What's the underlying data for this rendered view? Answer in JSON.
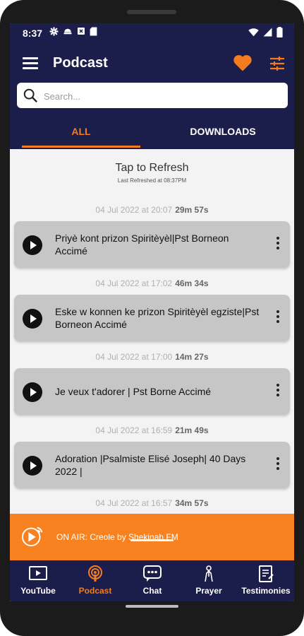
{
  "status_bar": {
    "time": "8:37"
  },
  "app_bar": {
    "title": "Podcast"
  },
  "search": {
    "placeholder": "Search..."
  },
  "tabs": [
    {
      "label": "ALL",
      "selected": true
    },
    {
      "label": "DOWNLOADS",
      "selected": false
    }
  ],
  "refresh": {
    "title": "Tap to Refresh",
    "subtitle": "Last Refreshed at  08:37PM"
  },
  "episodes": [
    {
      "date": "04 Jul 2022 at 20:07",
      "duration": "29m 57s",
      "title": "Priyè kont prizon Spiritèyèl|Pst Borneon Accimé"
    },
    {
      "date": "04 Jul 2022 at 17:02",
      "duration": "46m 34s",
      "title": "Eske w konnen ke prizon Spiritèyèl egziste|Pst Borneon Accimé"
    },
    {
      "date": "04 Jul 2022 at 17:00",
      "duration": "14m 27s",
      "title": "Je veux t'adorer | Pst Borne Accimé"
    },
    {
      "date": "04 Jul 2022 at 16:59",
      "duration": "21m 49s",
      "title": "Adoration |Psalmiste Elisé Joseph| 40 Days 2022 |"
    },
    {
      "date": "04 Jul 2022 at 16:57",
      "duration": "34m 57s",
      "title": ""
    }
  ],
  "now_playing": {
    "text": "ON AIR: Creole by Shekinah FM"
  },
  "bottom_nav": [
    {
      "label": "YouTube",
      "icon": "youtube-icon",
      "active": false
    },
    {
      "label": "Podcast",
      "icon": "podcast-icon",
      "active": true
    },
    {
      "label": "Chat",
      "icon": "chat-icon",
      "active": false
    },
    {
      "label": "Prayer",
      "icon": "prayer-icon",
      "active": false
    },
    {
      "label": "Testimonies",
      "icon": "testimonies-icon",
      "active": false
    }
  ],
  "colors": {
    "primary": "#1b1d4a",
    "accent": "#f47c20",
    "card": "#c6c6c6",
    "onair": "#f7821f"
  }
}
